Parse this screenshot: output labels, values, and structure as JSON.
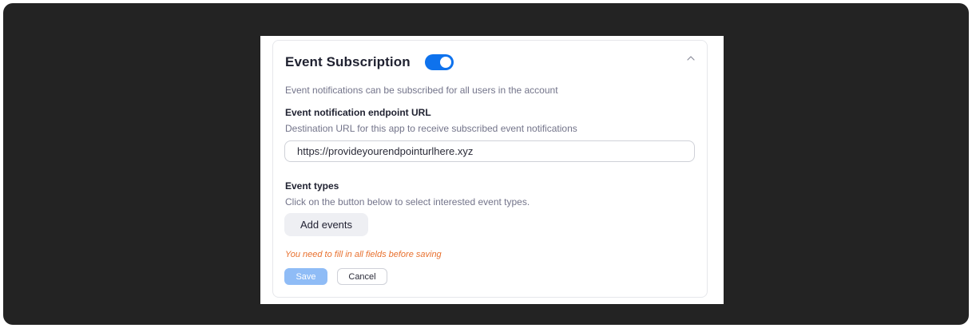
{
  "panel": {
    "title": "Event Subscription",
    "toggle_on": true,
    "accent_color": "#0e72ed",
    "collapse_icon": "chevron-up-icon",
    "description": "Event notifications can be subscribed for all users in the account"
  },
  "endpoint": {
    "label": "Event notification endpoint URL",
    "help": "Destination URL for this app to receive subscribed event notifications",
    "value": "https://provideyourendpointurlhere.xyz"
  },
  "event_types": {
    "label": "Event types",
    "help": "Click on the button below to select interested event types.",
    "add_button": "Add events"
  },
  "form": {
    "warning": "You need to fill in all fields before saving",
    "warning_color": "#e8712f",
    "save_label": "Save",
    "cancel_label": "Cancel"
  }
}
